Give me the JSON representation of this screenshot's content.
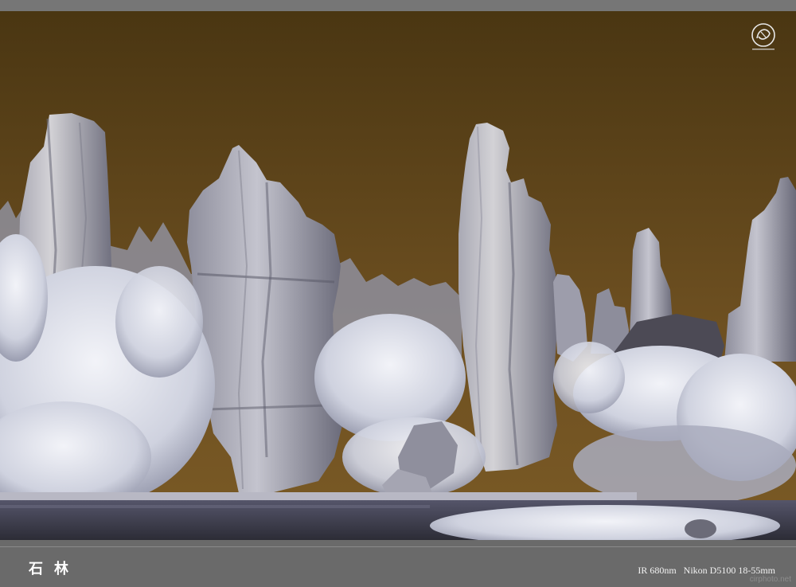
{
  "photo": {
    "subject": "stone-forest-infrared-landscape",
    "colors": {
      "sky_top": "#4a3612",
      "sky_bottom": "#7a5a25",
      "rock_light": "#c9c9d3",
      "rock_dark": "#5e5e6c",
      "foliage": "#e4e6ef",
      "water": "#3c3c44"
    }
  },
  "logo": {
    "icon": "seal-logo-icon"
  },
  "caption": {
    "title": "石林",
    "meta": "IR 680nm   Nikon D5100 18-55mm",
    "watermark": "cirphoto.net"
  }
}
